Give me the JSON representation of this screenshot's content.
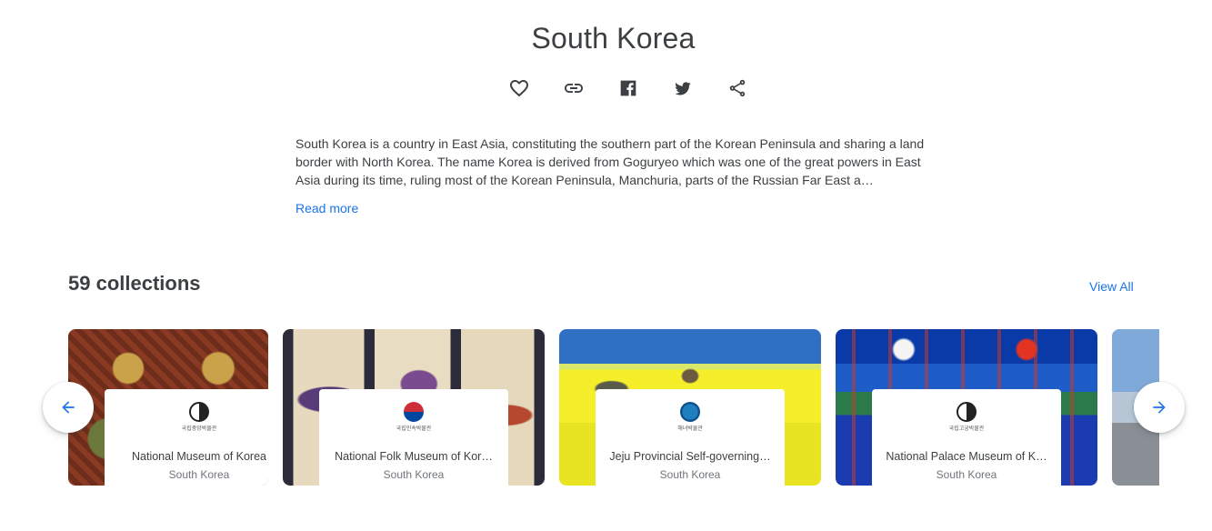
{
  "page": {
    "title": "South Korea",
    "description": "South Korea is a country in East Asia, constituting the southern part of the Korean Peninsula and sharing a land border with North Korea. The name Korea is derived from Goguryeo which was one of the great powers in East Asia during its time, ruling most of the Korean Peninsula, Manchuria, parts of the Russian Far East a…",
    "read_more": "Read more"
  },
  "actions": [
    {
      "icon": "heart-icon"
    },
    {
      "icon": "link-icon"
    },
    {
      "icon": "facebook-icon"
    },
    {
      "icon": "twitter-icon"
    },
    {
      "icon": "share-icon"
    }
  ],
  "collections": {
    "heading": "59 collections",
    "view_all": "View All",
    "items": [
      {
        "name": "National Museum of Korea",
        "country": "South Korea",
        "logo_text": "국립중앙박물관"
      },
      {
        "name": "National Folk Museum of Kor…",
        "country": "South Korea",
        "logo_text": "국립민속박물관"
      },
      {
        "name": "Jeju Provincial Self-governing…",
        "country": "South Korea",
        "logo_text": "해녀박물관"
      },
      {
        "name": "National Palace Museum of K…",
        "country": "South Korea",
        "logo_text": "국립고궁박물관"
      }
    ]
  },
  "nav": {
    "prev_icon": "arrow-left-icon",
    "next_icon": "arrow-right-icon"
  },
  "colors": {
    "accent": "#1a73e8",
    "text": "#3c4043",
    "muted": "#70757a"
  }
}
